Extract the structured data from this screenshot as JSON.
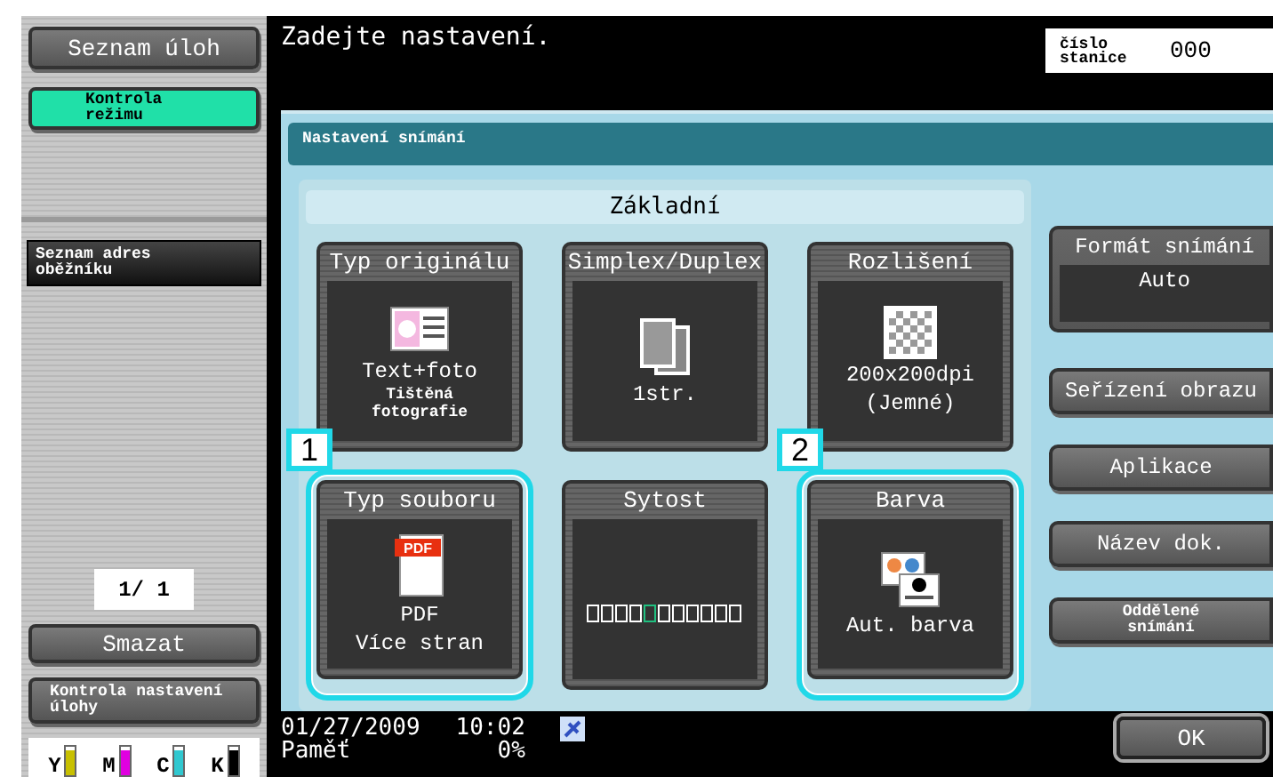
{
  "sidebar": {
    "job_list_button": "Seznam úloh",
    "mode_check_button": {
      "label": "Kontrola režimu",
      "selected": true
    },
    "address_list_button": "Seznam adres oběžníku",
    "page_counter": "1/ 1",
    "clear_button": "Smazat",
    "job_settings_button": "Kontrola nastavení úlohy",
    "toner": [
      {
        "label": "Y",
        "color": "#c8c000",
        "level": 0.9
      },
      {
        "label": "M",
        "color": "#e000e0",
        "level": 0.9
      },
      {
        "label": "C",
        "color": "#30c8d0",
        "level": 0.9
      },
      {
        "label": "K",
        "color": "#000000",
        "level": 0.9
      }
    ]
  },
  "message": "Zadejte nastavení.",
  "station": {
    "label": "číslo stanice",
    "value": "000"
  },
  "panel": {
    "title": "Nastavení snímání",
    "section": "Základní",
    "tiles": [
      {
        "kind": "original",
        "title": "Typ originálu",
        "lines": [
          "Text+foto"
        ],
        "small_lines": [
          "Tištěná",
          "fotografie"
        ],
        "highlighted": false
      },
      {
        "kind": "duplex",
        "title": "Simplex/Duplex",
        "lines": [
          "1str."
        ],
        "highlighted": false
      },
      {
        "kind": "resolution",
        "title": "Rozlišení",
        "lines": [
          "200x200dpi",
          "(Jemné)"
        ],
        "highlighted": false
      },
      {
        "kind": "filetype",
        "title": "Typ souboru",
        "lines": [
          "PDF",
          "Více stran"
        ],
        "highlighted": true,
        "callout": "1",
        "badge": "PDF"
      },
      {
        "kind": "density",
        "title": "Sytost",
        "highlighted": false,
        "segments": [
          {
            "selected": false
          },
          {
            "selected": false
          },
          {
            "selected": false
          },
          {
            "selected": false
          },
          {
            "selected": true
          },
          {
            "selected": false
          },
          {
            "selected": false
          },
          {
            "selected": false
          },
          {
            "selected": false
          },
          {
            "selected": false
          },
          {
            "selected": false
          }
        ]
      },
      {
        "kind": "color",
        "title": "Barva",
        "lines": [
          "Aut. barva"
        ],
        "highlighted": true,
        "callout": "2"
      }
    ],
    "scan_format": {
      "label": "Formát snímání",
      "value": "Auto"
    },
    "side_buttons": [
      {
        "label": "Seřízení obrazu",
        "small": false
      },
      {
        "label": "Aplikace",
        "small": false
      },
      {
        "label": "Název dok.",
        "small": false
      },
      {
        "label": "Oddělené snímání",
        "small": true
      }
    ]
  },
  "status_bar": {
    "date": "01/27/2009",
    "time": "10:02",
    "memory_label": "Paměť",
    "memory_value": "0%"
  },
  "ok_button": "OK"
}
